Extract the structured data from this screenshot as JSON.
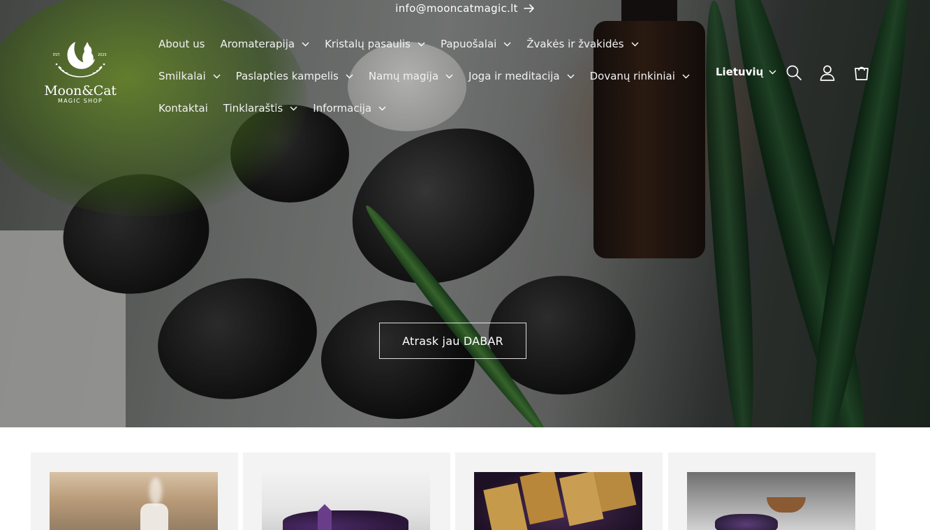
{
  "announcement": {
    "email": "info@mooncatmagic.lt"
  },
  "logo": {
    "name": "Moon&Cat",
    "subtitle": "MAGIC SHOP",
    "est": "EST.",
    "year": "2025"
  },
  "nav": {
    "row1": [
      {
        "label": "About us",
        "dropdown": false
      },
      {
        "label": "Aromaterapija",
        "dropdown": true
      },
      {
        "label": "Kristalų pasaulis",
        "dropdown": true
      },
      {
        "label": "Papuošalai",
        "dropdown": true
      },
      {
        "label": "Žvakės ir žvakidės",
        "dropdown": true
      }
    ],
    "row2": [
      {
        "label": "Smilkalai",
        "dropdown": true
      },
      {
        "label": "Paslapties kampelis",
        "dropdown": true
      },
      {
        "label": "Namų magija",
        "dropdown": true
      },
      {
        "label": "Joga ir meditacija",
        "dropdown": true
      },
      {
        "label": "Dovanų rinkiniai",
        "dropdown": true
      }
    ],
    "row3": [
      {
        "label": "Kontaktai",
        "dropdown": false
      },
      {
        "label": "Tinklaraštis",
        "dropdown": true
      },
      {
        "label": "Informacija",
        "dropdown": true
      }
    ]
  },
  "header": {
    "language": "Lietuvių",
    "icons": [
      "search-icon",
      "account-icon",
      "cart-icon"
    ]
  },
  "hero": {
    "cta_label": "Atrask jau DABAR"
  },
  "collections": [
    {
      "image": "aromatherapy-diffuser"
    },
    {
      "image": "amethyst-crystals"
    },
    {
      "image": "tarot-cards"
    },
    {
      "image": "crystal-altar"
    }
  ],
  "colors": {
    "text_on_hero": "#ffffff",
    "card_bg": "#f3f3f3"
  }
}
